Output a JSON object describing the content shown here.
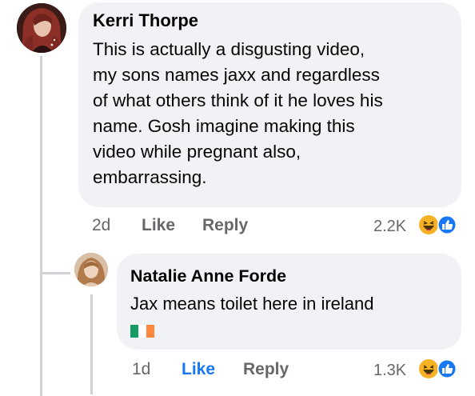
{
  "comments": [
    {
      "author": "Kerri Thorpe",
      "lines": [
        "This is actually a disgusting video,",
        "my sons names jaxx and regardless",
        "of what others think of it he loves his",
        "name. Gosh imagine making this",
        "video while pregnant also,",
        "embarrassing."
      ],
      "time": "2d",
      "like_label": "Like",
      "reply_label": "Reply",
      "reaction_count": "2.2K",
      "reactions": [
        "haha-icon",
        "like-icon"
      ]
    },
    {
      "author": "Natalie Anne Forde",
      "lines": [
        "Jax means toilet here in ireland"
      ],
      "flag": "ireland-flag-emoji",
      "time": "1d",
      "like_label": "Like",
      "reply_label": "Reply",
      "reaction_count": "1.3K",
      "reactions": [
        "haha-icon",
        "like-icon"
      ],
      "liked": true
    }
  ],
  "colors": {
    "bubble": "#f0f2f5",
    "meta_text": "#65676b",
    "like_active": "#1877f2",
    "haha": "#f7b125",
    "like_reaction": "#1877f2",
    "thread_line": "#cfd3d8"
  }
}
